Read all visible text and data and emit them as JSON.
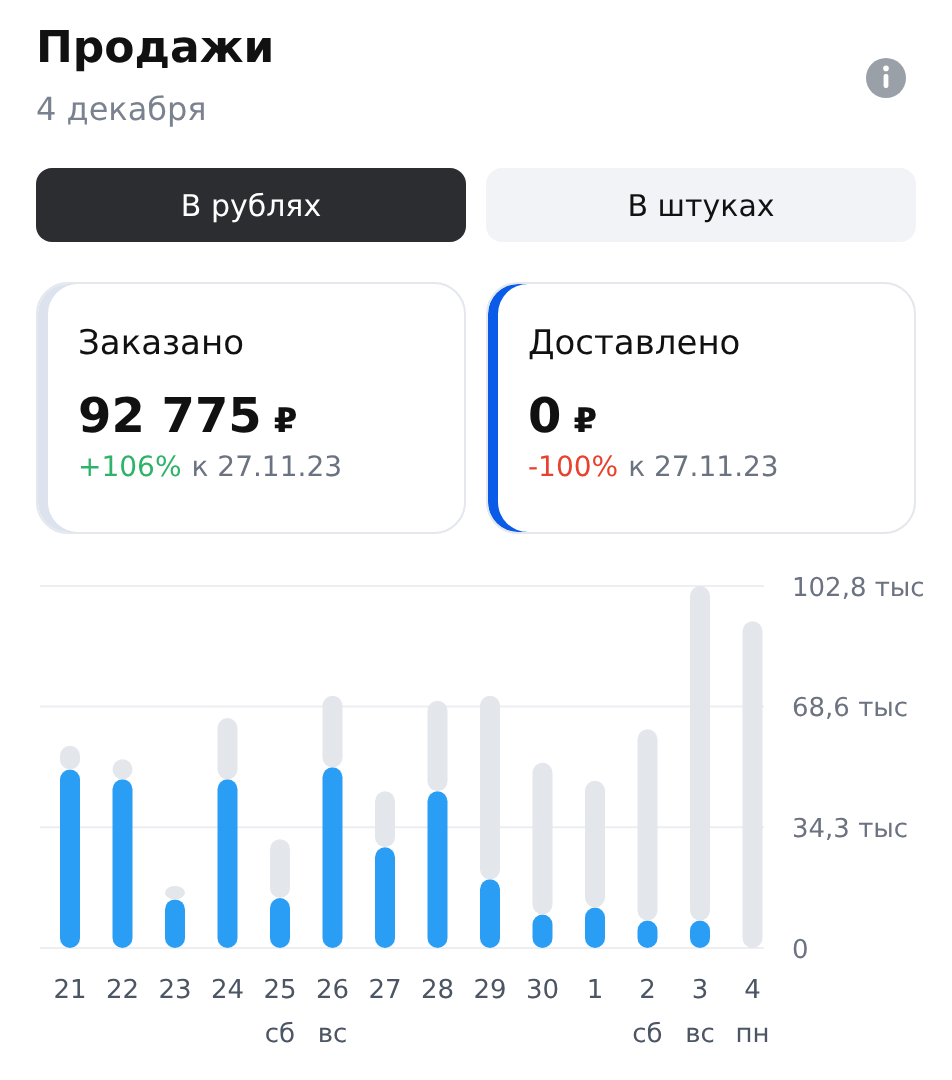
{
  "header": {
    "title": "Продажи",
    "date": "4 декабря"
  },
  "toggle": [
    {
      "label": "В рублях",
      "selected": true
    },
    {
      "label": "В штуках",
      "selected": false
    }
  ],
  "cards": [
    {
      "title": "Заказано",
      "value": "92 775",
      "currency": "₽",
      "change": {
        "text": "+106%",
        "color": "#2fb36a"
      },
      "compare": "к 27.11.23",
      "color": "#dde3ee"
    },
    {
      "title": "Доставлено",
      "value": "0",
      "currency": "₽",
      "change": {
        "text": "-100%",
        "color": "#e8422e"
      },
      "compare": "к 27.11.23",
      "color": "#0a5be8"
    }
  ],
  "chart": {
    "chart_data": {
      "type": "bar",
      "categories": [
        "21",
        "22",
        "23",
        "24",
        "25\nсб",
        "26\nвс",
        "27",
        "28",
        "29",
        "30",
        "1",
        "2\nсб",
        "3\nвс",
        "4\nпн"
      ],
      "series": [
        {
          "color": "#2a9df4",
          "values": [
            50.7,
            47.9,
            13.8,
            47.9,
            14.2,
            51.3,
            28.6,
            44.5,
            19.5,
            9.5,
            11.5,
            7.8,
            7.8,
            null
          ]
        },
        {
          "color": "#e3e6eb",
          "values": [
            6.7,
            5.7,
            3.8,
            17.4,
            16.7,
            20.3,
            15.9,
            25.7,
            52.1,
            43.1,
            36.0,
            54.3,
            95.0,
            92.8
          ]
        }
      ],
      "stacked": true,
      "ylim": [
        0,
        102.8
      ],
      "yticks": [
        {
          "value": 0,
          "label": "0"
        },
        {
          "value": 34.3,
          "label": "34,3 тыс"
        },
        {
          "value": 68.6,
          "label": "68,6 тыс"
        },
        {
          "value": 102.8,
          "label": "102,8 тыс"
        }
      ]
    }
  }
}
